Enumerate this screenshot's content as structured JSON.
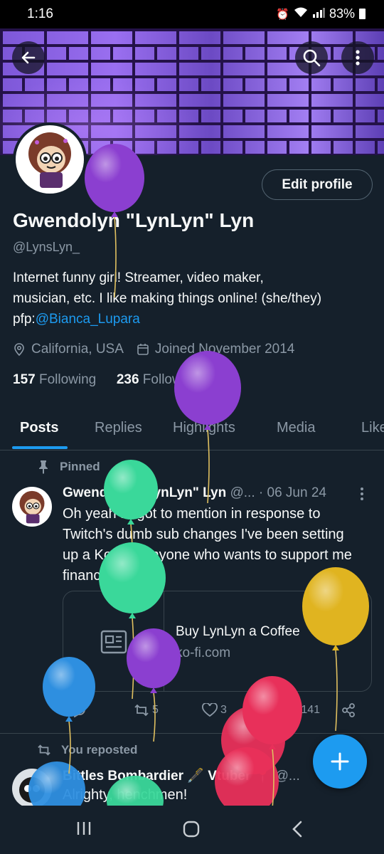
{
  "status_bar": {
    "time": "1:16",
    "battery": "83%"
  },
  "profile": {
    "edit_button": "Edit profile",
    "name": "Gwendolyn \"LynLyn\" Lyn",
    "handle": "@LynsLyn_",
    "bio_line1": "Internet funny girl!   Streamer, video maker,",
    "bio_line2": "musician, etc.  I like making things online!  (she/they)",
    "bio_pfp_prefix": "pfp:",
    "bio_pfp_mention": "@Bianca_Lupara",
    "location": "California, USA",
    "joined": "Joined November 2014",
    "following_count": "157",
    "following_label": "Following",
    "followers_count": "236",
    "followers_label": "Followers"
  },
  "tabs": [
    {
      "label": "Posts",
      "active": true
    },
    {
      "label": "Replies"
    },
    {
      "label": "Highlights"
    },
    {
      "label": "Media"
    },
    {
      "label": "Likes"
    }
  ],
  "pinned_tweet": {
    "pinned_label": "Pinned",
    "author_name": "Gwendolyn \"LynLyn\" Lyn",
    "author_handle": "@...",
    "date": "· 06 Jun 24",
    "text": "Oh yeah forgot to mention in response to Twitch's dumb sub changes I've been setting up a Kofi for anyone who wants to support me financially.",
    "card_title": "Buy LynLyn a Coffee",
    "card_domain": "ko-fi.com",
    "retweets": "5",
    "likes": "3",
    "views": "1,141"
  },
  "repost_tweet": {
    "repost_label": "You reposted",
    "author_name": "Bittles Bombardier 🖋️ Vtuber 📍",
    "author_handle": "@...",
    "text": "Alrighty, henchmen!"
  },
  "colors": {
    "accent": "#1d9bf0",
    "background": "#15202b",
    "muted": "#8b98a5"
  },
  "balloons": [
    {
      "color": "#8b3fd0"
    },
    {
      "color": "#8b3fd0"
    },
    {
      "color": "#3ad89a"
    },
    {
      "color": "#3ad89a"
    },
    {
      "color": "#8b3fd0"
    },
    {
      "color": "#2e8fe0"
    },
    {
      "color": "#e0b420"
    },
    {
      "color": "#e8305a"
    }
  ]
}
